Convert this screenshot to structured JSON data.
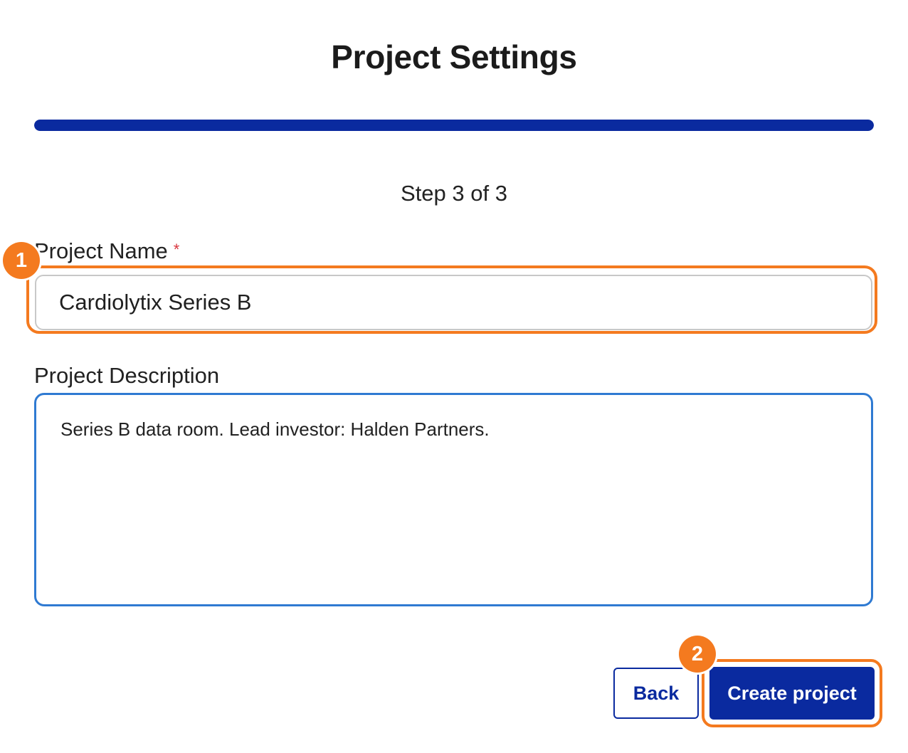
{
  "page": {
    "title": "Project Settings",
    "step_text": "Step 3 of 3",
    "progress_fraction": 1.0
  },
  "form": {
    "name_label": "Project Name",
    "required_marker": "*",
    "name_value": "Cardiolytix Series B",
    "description_label": "Project Description",
    "description_value": "Series B data room. Lead investor: Halden Partners."
  },
  "actions": {
    "back_label": "Back",
    "create_label": "Create project"
  },
  "annotations": {
    "badge_1": "1",
    "badge_2": "2"
  },
  "colors": {
    "primary": "#0a2a9f",
    "highlight": "#f47a1f",
    "focus_border": "#2f7ad2",
    "required": "#d9363e"
  }
}
